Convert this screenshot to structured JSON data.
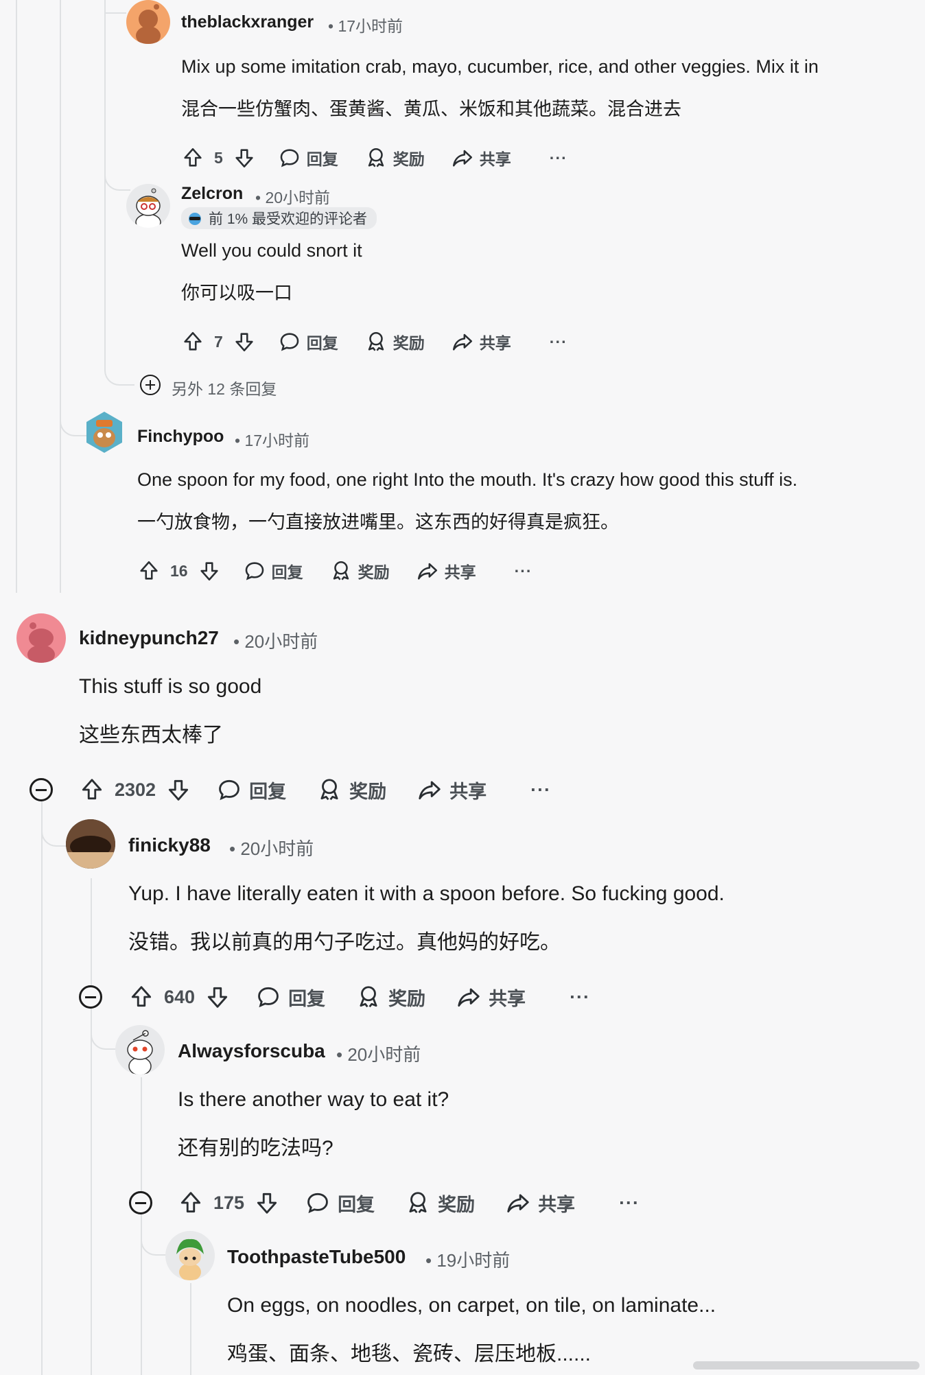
{
  "actions": {
    "reply": "回复",
    "award": "奖励",
    "share": "共享",
    "more": "···"
  },
  "comments": [
    {
      "author": "theblackxranger",
      "time": "• 17小时前",
      "text_en": "Mix up some imitation crab, mayo, cucumber, rice, and other veggies. Mix it in",
      "text_zh": "混合一些仿蟹肉、蛋黄酱、黄瓜、米饭和其他蔬菜。混合进去",
      "votes": "5"
    },
    {
      "author": "Zelcron",
      "time": "• 20小时前",
      "badge": "前 1% 最受欢迎的评论者",
      "text_en": "Well you could snort it",
      "text_zh": "你可以吸一口",
      "votes": "7"
    },
    {
      "author": "Finchypoo",
      "time": "• 17小时前",
      "text_en": "One spoon for my food, one right Into the mouth. It's crazy how good this stuff is.",
      "text_zh": "一勺放食物，一勺直接放进嘴里。这东西的好得真是疯狂。",
      "votes": "16"
    },
    {
      "author": "kidneypunch27",
      "time": "• 20小时前",
      "text_en": "This stuff is so good",
      "text_zh": "这些东西太棒了",
      "votes": "2302"
    },
    {
      "author": "finicky88",
      "time": "• 20小时前",
      "text_en": "Yup. I have literally eaten it with a spoon before. So fucking good.",
      "text_zh": "没错。我以前真的用勺子吃过。真他妈的好吃。",
      "votes": "640"
    },
    {
      "author": "Alwaysforscuba",
      "time": "• 20小时前",
      "text_en": "Is there another way to eat it?",
      "text_zh": "还有别的吃法吗?",
      "votes": "175"
    },
    {
      "author": "ToothpasteTube500",
      "time": "• 19小时前",
      "text_en": "On eggs, on noodles, on carpet, on tile, on laminate...",
      "text_zh": "鸡蛋、面条、地毯、瓷砖、层压地板......"
    }
  ],
  "more_replies": "另外 12 条回复",
  "colors": {
    "background": "#f7f7f8",
    "thread_line": "#dfe1e3",
    "text": "#1c1c1c",
    "meta": "#5c6166"
  }
}
